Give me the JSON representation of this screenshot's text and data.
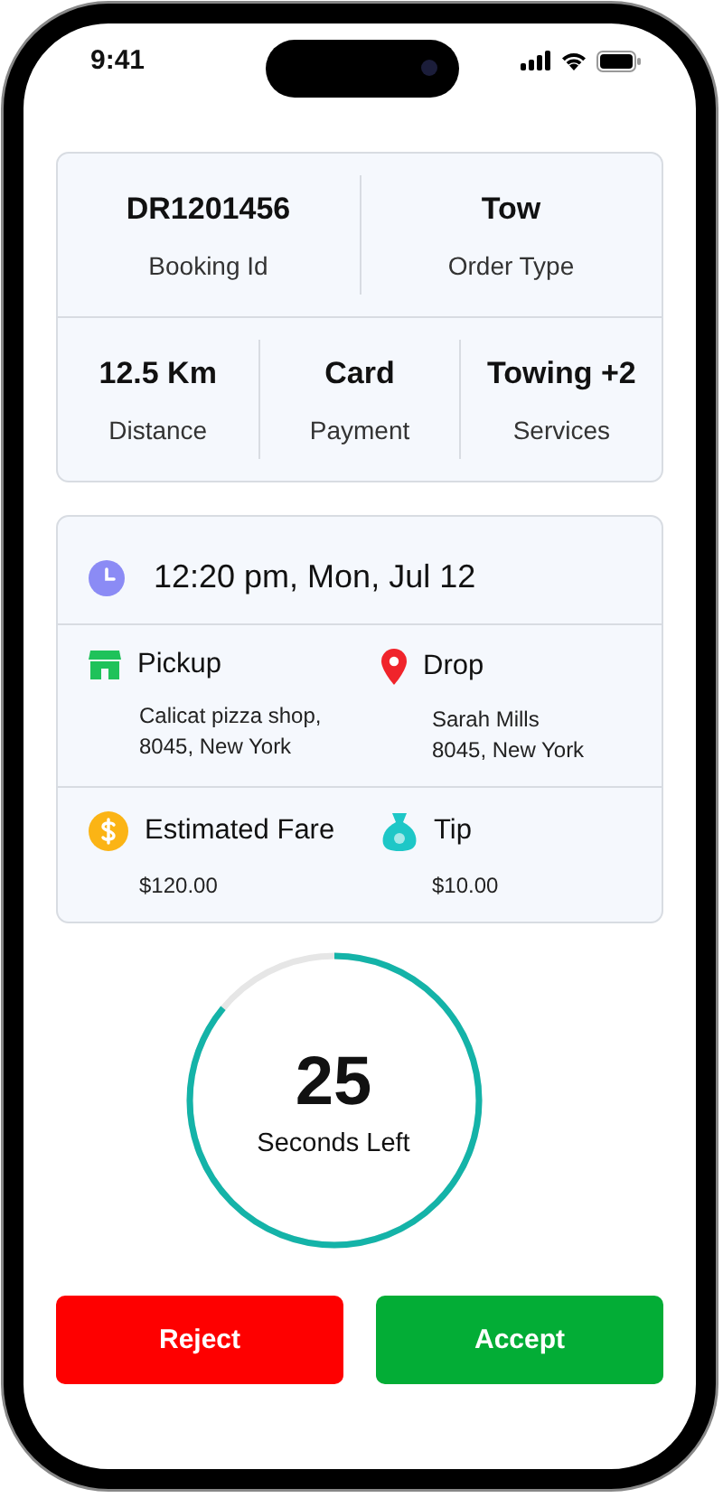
{
  "status_bar": {
    "time": "9:41"
  },
  "booking": {
    "stats": [
      {
        "value": "DR1201456",
        "label": "Booking Id"
      },
      {
        "value": "Tow",
        "label": "Order Type"
      }
    ]
  },
  "order": {
    "stats": [
      {
        "value": "12.5 Km",
        "label": "Distance"
      },
      {
        "value": "Card",
        "label": "Payment"
      },
      {
        "value": "Towing +2",
        "label": "Services"
      }
    ]
  },
  "trip": {
    "schedule": "12:20 pm, Mon, Jul 12",
    "locations": [
      {
        "kind": "pickup",
        "title": "Pickup",
        "lines": [
          "Calicat pizza shop,",
          "8045, New York"
        ]
      },
      {
        "kind": "drop",
        "title": "Drop",
        "lines": [
          "Sarah Mills",
          "8045, New York"
        ]
      }
    ],
    "amounts": [
      {
        "kind": "fare",
        "title": "Estimated Fare",
        "amount": "$120.00"
      },
      {
        "kind": "tip",
        "title": "Tip",
        "amount": "$10.00"
      }
    ]
  },
  "timer": {
    "value": "25",
    "label": "Seconds Left",
    "level": 0.86
  },
  "buttons": [
    {
      "kind": "reject",
      "label": "Reject"
    },
    {
      "kind": "accept",
      "label": "Accept"
    }
  ]
}
